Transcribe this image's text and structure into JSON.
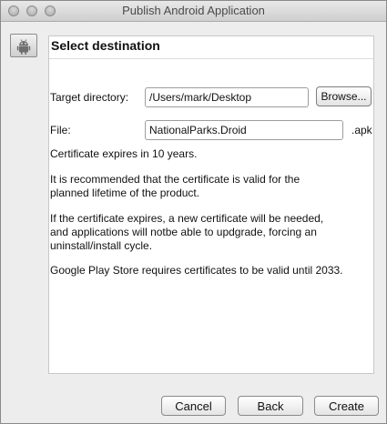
{
  "window": {
    "title": "Publish Android Application"
  },
  "icons": {
    "window_controls": [
      "close-icon",
      "minimize-icon",
      "zoom-icon"
    ],
    "badge": "android-icon"
  },
  "panel": {
    "title": "Select destination"
  },
  "form": {
    "target_label": "Target directory:",
    "target_value": "/Users/mark/Desktop",
    "browse_label": "Browse...",
    "file_label": "File:",
    "file_value": "NationalParks.Droid",
    "file_ext": ".apk"
  },
  "messages": {
    "cert_expiry": "Certificate expires in 10 years.",
    "rec_line1": "It is recommended that the certificate is valid for the",
    "rec_line2": "planned lifetime of the product.",
    "exp_line1": "If the certificate expires, a new certificate will be needed,",
    "exp_line2": "and applications will notbe able to updgrade, forcing an",
    "exp_line3": "uninstall/install cycle.",
    "play_store": "Google Play Store requires certificates to be valid until 2033."
  },
  "footer": {
    "cancel": "Cancel",
    "back": "Back",
    "create": "Create"
  }
}
